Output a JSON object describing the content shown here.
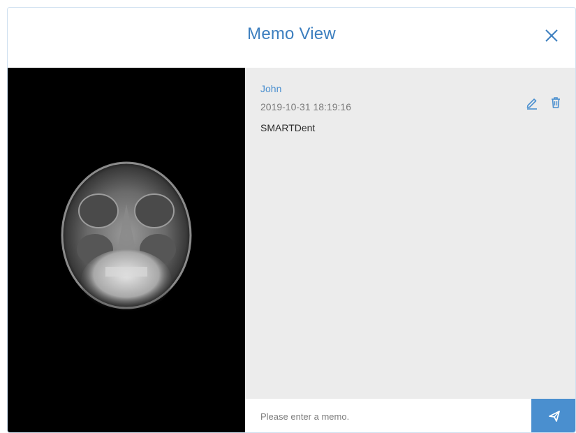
{
  "dialog": {
    "title": "Memo View",
    "close_icon": "close-icon"
  },
  "image": {
    "description_icon": "xray-image",
    "background": "#000000"
  },
  "memo": {
    "author": "John",
    "timestamp": "2019-10-31 18:19:16",
    "text": "SMARTDent",
    "edit_icon": "edit-icon",
    "delete_icon": "trash-icon"
  },
  "input": {
    "placeholder": "Please enter a memo.",
    "value": "",
    "send_icon": "send-icon"
  },
  "colors": {
    "accent": "#4a8fcf",
    "title": "#3d7fbf",
    "panel_bg": "#ececec"
  }
}
